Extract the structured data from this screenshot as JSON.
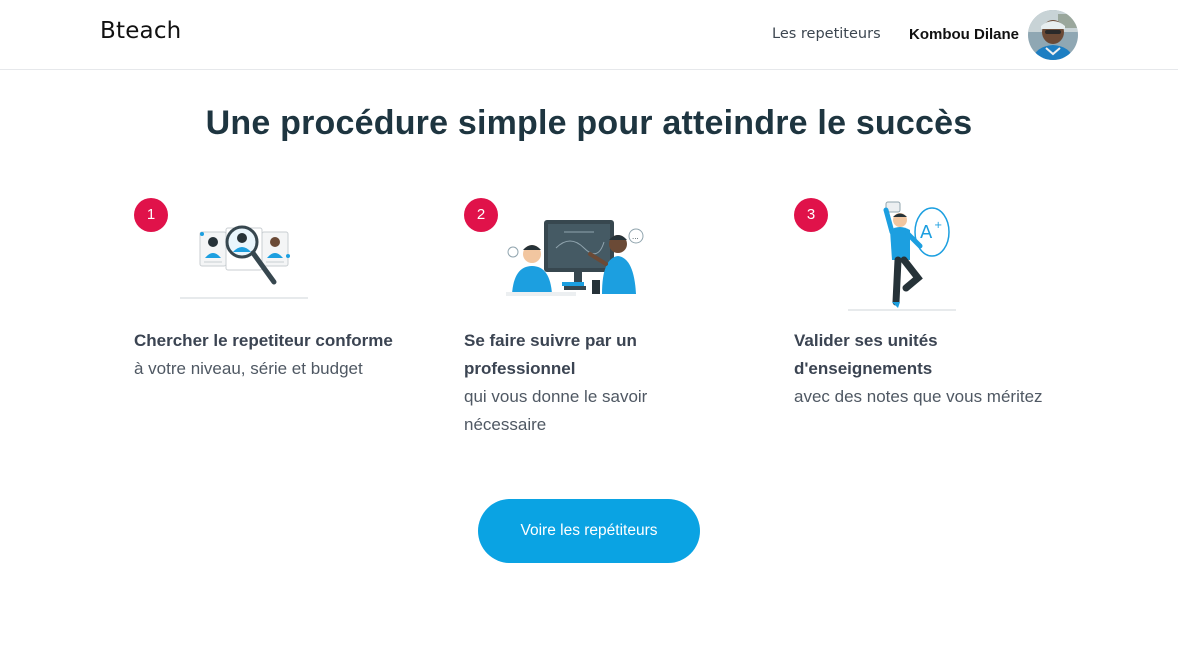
{
  "navbar": {
    "brand": "Bteach",
    "links": [
      {
        "label": "Les repetiteurs"
      }
    ],
    "user": {
      "name": "Kombou Dilane"
    }
  },
  "main": {
    "title": "Une procédure simple pour atteindre le succès",
    "steps": [
      {
        "number": "1",
        "title": "Chercher le repetiteur conforme",
        "description": "à votre niveau, série et budget",
        "illustration": "search-tutor-illustration"
      },
      {
        "number": "2",
        "title": "Se faire suivre par un professionnel",
        "description": "qui vous donne le savoir nécessaire",
        "illustration": "tutoring-session-illustration"
      },
      {
        "number": "3",
        "title": "Valider ses unités d'enseignements",
        "description": "avec des notes que vous méritez",
        "illustration": "success-grade-illustration"
      }
    ],
    "cta_label": "Voire les repétiteurs"
  },
  "colors": {
    "accent": "#0aa3e3",
    "badge": "#e0124a",
    "title": "#1e3540",
    "illustration_blue": "#1c9fe0"
  }
}
